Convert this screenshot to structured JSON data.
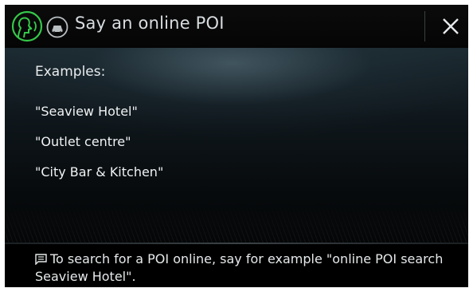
{
  "header": {
    "title": "Say an online POI",
    "voice_icon": "voice-recognition-icon",
    "poi_icon": "online-poi-icon",
    "close_icon": "close-icon"
  },
  "examples": {
    "heading": "Examples:",
    "items": [
      "\"Seaview Hotel\"",
      "\"Outlet centre\"",
      "\"City Bar & Kitchen\""
    ]
  },
  "hint": {
    "icon": "message-icon",
    "text": "To search for a POI online, say for example \"online POI search Seaview Hotel\"."
  },
  "colors": {
    "voice_accent": "#35c84a",
    "text": "#e8ecee",
    "background": "#000000"
  }
}
